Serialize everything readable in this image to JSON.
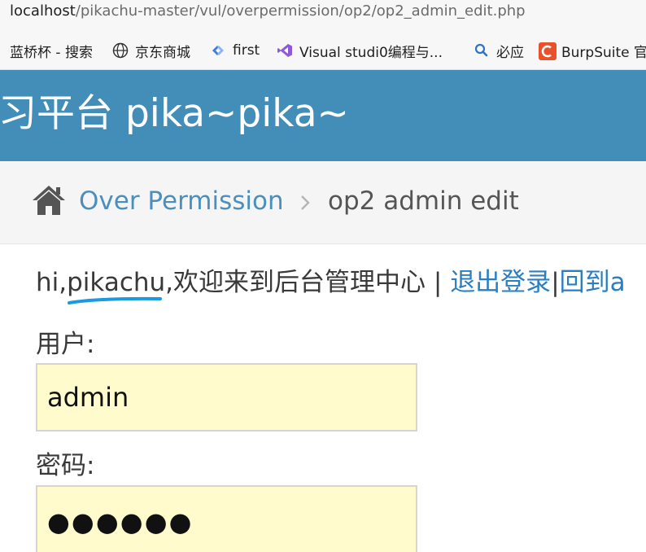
{
  "browser": {
    "url_host": "localhost",
    "url_path": "/pikachu-master/vul/overpermission/op2/op2_admin_edit.php",
    "bookmarks": [
      {
        "label": "蓝桥杯 - 搜索",
        "icon": "none"
      },
      {
        "label": "京东商城",
        "icon": "globe-icon"
      },
      {
        "label": "first",
        "icon": "diamond-icon"
      },
      {
        "label": "Visual studi0编程与...",
        "icon": "visual-studio-icon"
      },
      {
        "label": "必应",
        "icon": "search-icon"
      },
      {
        "label": "BurpSuite 官",
        "icon": "burp-c-icon"
      }
    ]
  },
  "header": {
    "title": "习平台 pika~pika~"
  },
  "breadcrumb": {
    "link": "Over Permission",
    "current": "op2 admin edit"
  },
  "greeting": {
    "prefix": "hi,",
    "username": "pikachu",
    "suffix": ",欢迎来到后台管理中心",
    "divider": " | ",
    "logout": "退出登录",
    "pipe": "|",
    "back": "回到a"
  },
  "form": {
    "user_label": "用户:",
    "user_value": "admin",
    "pass_label": "密码:",
    "pass_value": "●●●●●●"
  },
  "colors": {
    "header_bg": "#438eb9",
    "link": "#4c8fbd",
    "input_bg": "#fffbcc",
    "annotation": "#1a9ae0"
  }
}
